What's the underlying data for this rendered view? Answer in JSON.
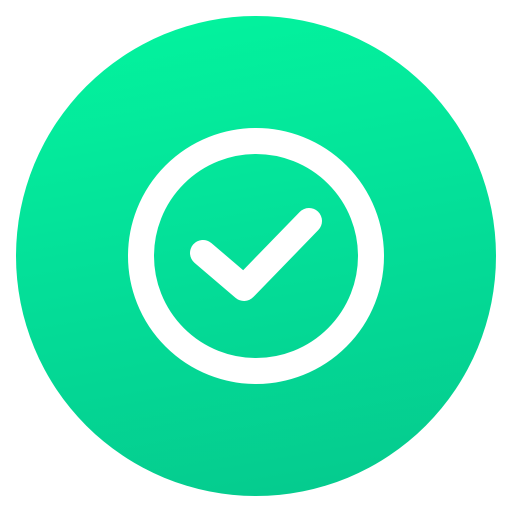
{
  "icon": {
    "name": "check-circle-icon",
    "background_gradient": [
      "#03f59e",
      "#04e099",
      "#05c98d"
    ],
    "foreground": "#ffffff"
  }
}
